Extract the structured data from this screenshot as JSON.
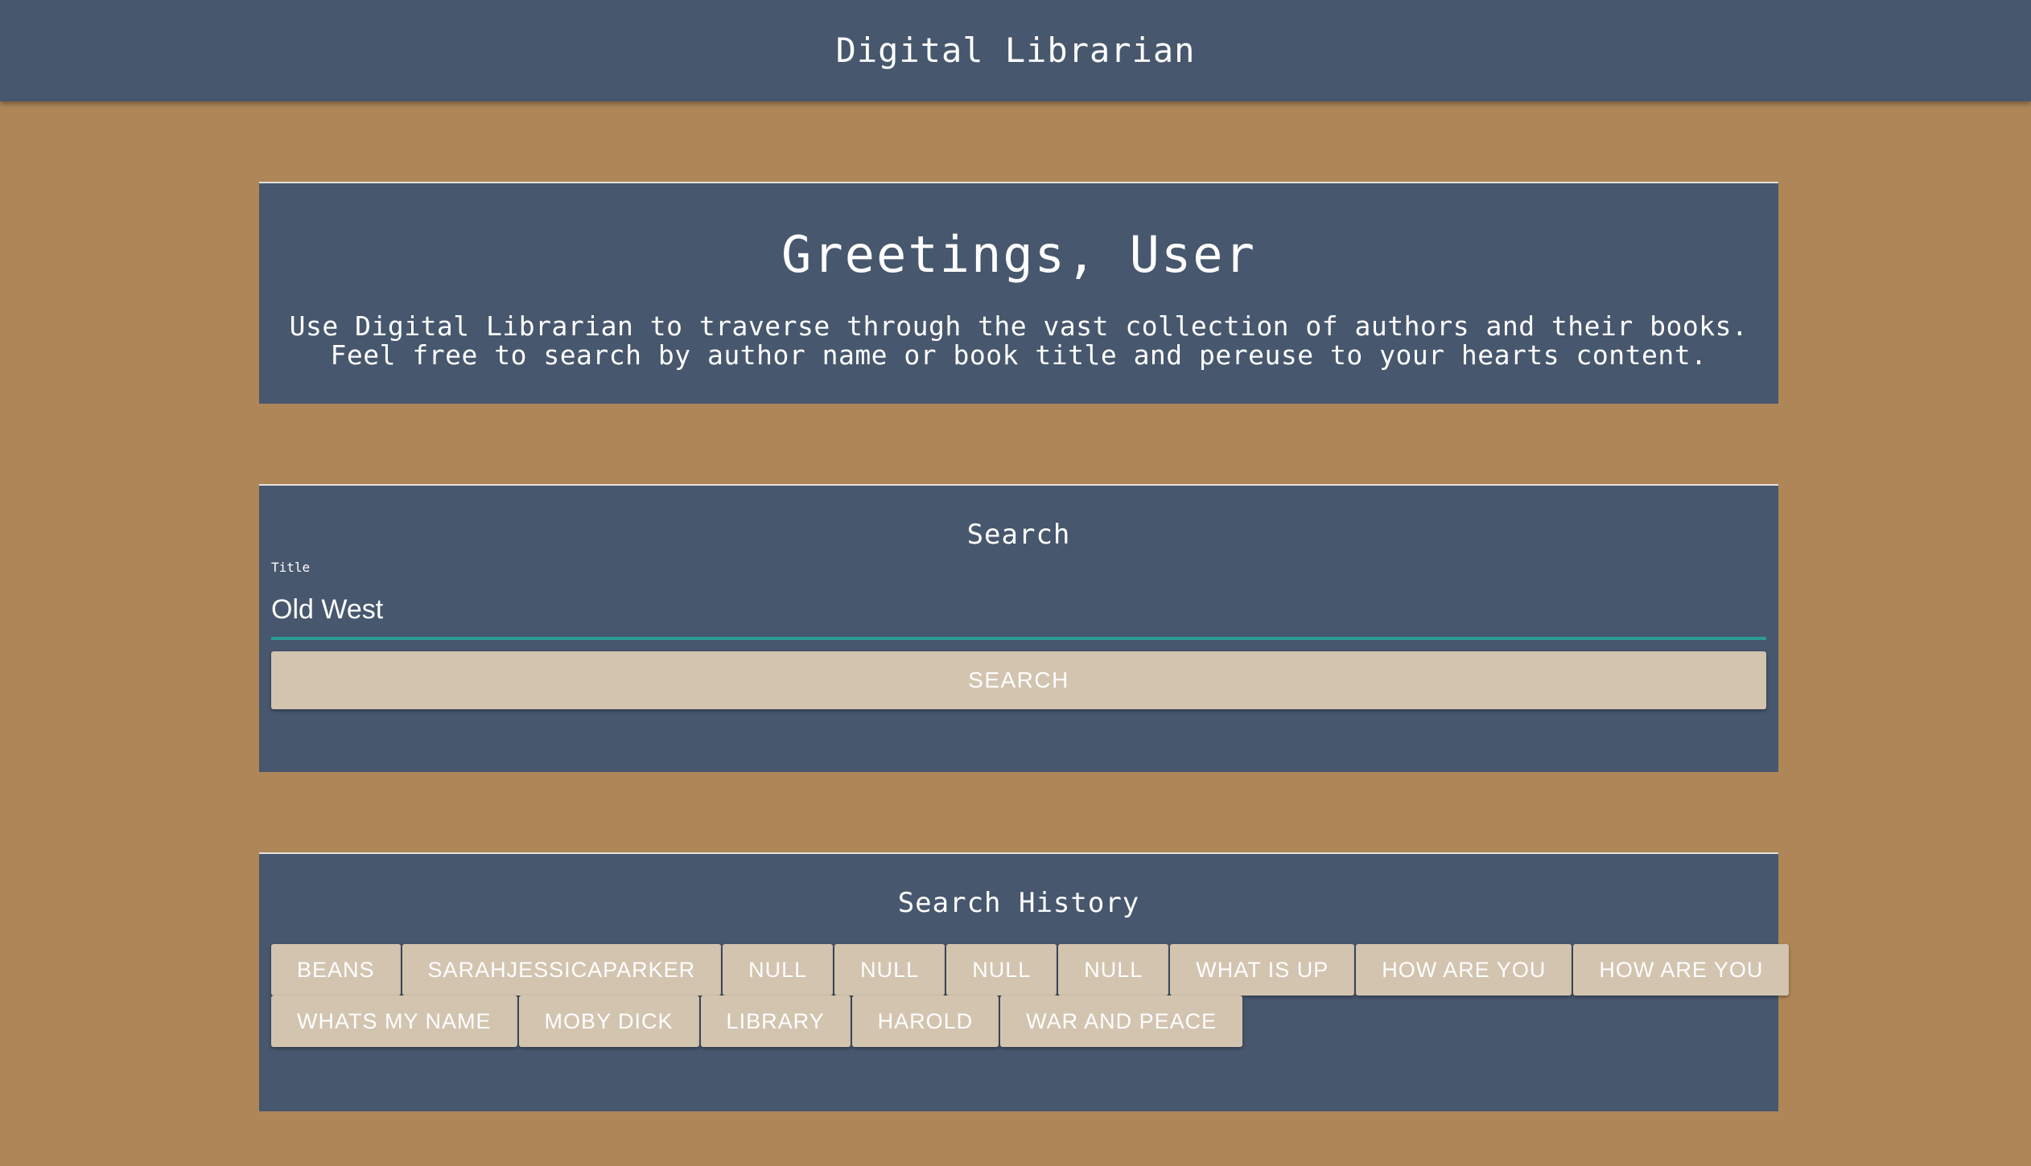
{
  "header": {
    "title": "Digital Librarian"
  },
  "greeting": {
    "heading": "Greetings, User",
    "text": "Use Digital Librarian to traverse through the vast collection of authors and their books. Feel free to search by author name or book title and pereuse to your hearts content."
  },
  "search": {
    "heading": "Search",
    "field_label": "Title",
    "field_value": "Old West",
    "button_label": "SEARCH"
  },
  "history": {
    "heading": "Search History",
    "rows": [
      [
        "BEANS",
        "SARAHJESSICAPARKER",
        "NULL",
        "NULL",
        "NULL",
        "NULL",
        "WHAT IS UP",
        "HOW ARE YOU",
        "HOW ARE YOU"
      ],
      [
        "WHATS MY NAME",
        "MOBY DICK",
        "LIBRARY",
        "HAROLD",
        "WAR AND PEACE"
      ]
    ]
  },
  "colors": {
    "background": "#af8658",
    "panel": "#47576d",
    "button": "#d3c4b0",
    "input_underline": "#2b9c93",
    "text": "#ffffff"
  }
}
